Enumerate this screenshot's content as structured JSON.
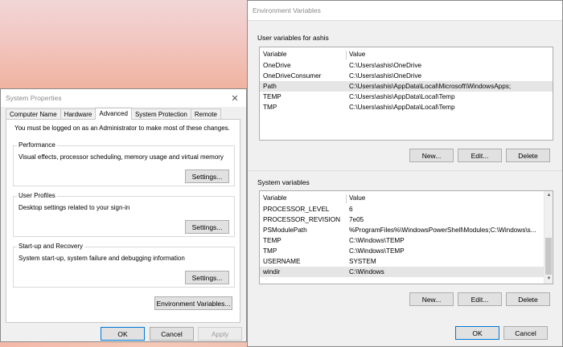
{
  "sysprops": {
    "title": "System Properties",
    "tabs": [
      "Computer Name",
      "Hardware",
      "Advanced",
      "System Protection",
      "Remote"
    ],
    "active_tab": "Advanced",
    "admin_note": "You must be logged on as an Administrator to make most of these changes.",
    "performance": {
      "label": "Performance",
      "desc": "Visual effects, processor scheduling, memory usage and virtual memory",
      "button": "Settings..."
    },
    "profiles": {
      "label": "User Profiles",
      "desc": "Desktop settings related to your sign-in",
      "button": "Settings..."
    },
    "startup": {
      "label": "Start-up and Recovery",
      "desc": "System start-up, system failure and debugging information",
      "button": "Settings..."
    },
    "env_button": "Environment Variables...",
    "ok": "OK",
    "cancel": "Cancel",
    "apply": "Apply"
  },
  "envvars": {
    "title": "Environment Variables",
    "user_label": "User variables for ashis",
    "system_label": "System variables",
    "col_variable": "Variable",
    "col_value": "Value",
    "user_rows": [
      {
        "variable": "OneDrive",
        "value": "C:\\Users\\ashis\\OneDrive"
      },
      {
        "variable": "OneDriveConsumer",
        "value": "C:\\Users\\ashis\\OneDrive"
      },
      {
        "variable": "Path",
        "value": "C:\\Users\\ashis\\AppData\\Local\\Microsoft\\WindowsApps;"
      },
      {
        "variable": "TEMP",
        "value": "C:\\Users\\ashis\\AppData\\Local\\Temp"
      },
      {
        "variable": "TMP",
        "value": "C:\\Users\\ashis\\AppData\\Local\\Temp"
      }
    ],
    "system_rows": [
      {
        "variable": "PROCESSOR_LEVEL",
        "value": "6"
      },
      {
        "variable": "PROCESSOR_REVISION",
        "value": "7e05"
      },
      {
        "variable": "PSModulePath",
        "value": "%ProgramFiles%\\WindowsPowerShell\\Modules;C:\\Windows\\s..."
      },
      {
        "variable": "TEMP",
        "value": "C:\\Windows\\TEMP"
      },
      {
        "variable": "TMP",
        "value": "C:\\Windows\\TEMP"
      },
      {
        "variable": "USERNAME",
        "value": "SYSTEM"
      },
      {
        "variable": "windir",
        "value": "C:\\Windows"
      }
    ],
    "new": "New...",
    "edit": "Edit...",
    "delete": "Delete",
    "ok": "OK",
    "cancel": "Cancel"
  }
}
